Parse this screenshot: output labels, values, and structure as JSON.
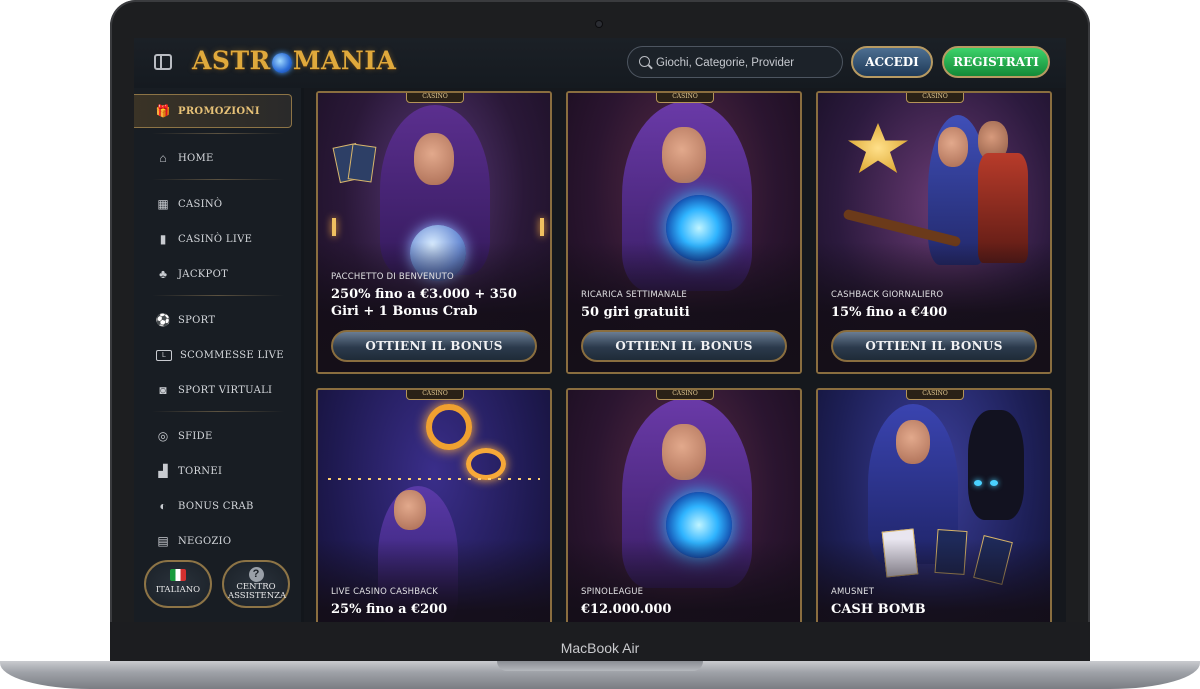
{
  "device": {
    "label": "MacBook Air"
  },
  "header": {
    "logo_text": "ASTROMANIA",
    "search": {
      "placeholder": "Giochi, Categorie, Provider",
      "value": ""
    },
    "login_label": "ACCEDI",
    "register_label": "REGISTRATI"
  },
  "sidebar": {
    "promo": {
      "label": "PROMOZIONI",
      "icon": "gift-icon"
    },
    "items": [
      {
        "label": "HOME",
        "icon": "home-icon"
      },
      {
        "label": "CASINÒ",
        "icon": "slot-machine-icon"
      },
      {
        "label": "CASINÒ LIVE",
        "icon": "playing-card-icon"
      },
      {
        "label": "JACKPOT",
        "icon": "clover-icon"
      },
      {
        "label": "SPORT",
        "icon": "soccer-ball-icon"
      },
      {
        "label": "SCOMMESSE LIVE",
        "icon": "live-icon"
      },
      {
        "label": "SPORT VIRTUALI",
        "icon": "virtual-sport-icon"
      },
      {
        "label": "SFIDE",
        "icon": "target-icon"
      },
      {
        "label": "TORNEI",
        "icon": "podium-icon"
      },
      {
        "label": "BONUS CRAB",
        "icon": "claw-icon"
      },
      {
        "label": "NEGOZIO",
        "icon": "shop-icon"
      }
    ],
    "language_label": "ITALIANO",
    "help_label": "CENTRO ASSISTENZA"
  },
  "promotions": {
    "badge": "CASINO",
    "cards": [
      {
        "subtitle": "PACCHETTO DI BENVENUTO",
        "title": "250% fino a €3.000 + 350 Giri + 1 Bonus Crab",
        "cta": "OTTIENI IL BONUS"
      },
      {
        "subtitle": "RICARICA SETTIMANALE",
        "title": "50 giri gratuiti",
        "cta": "OTTIENI IL BONUS"
      },
      {
        "subtitle": "CASHBACK GIORNALIERO",
        "title": "15% fino a €400",
        "cta": "OTTIENI IL BONUS"
      },
      {
        "subtitle": "LIVE CASINO CASHBACK",
        "title": "25% fino a €200",
        "cta": ""
      },
      {
        "subtitle": "SPINOLEAGUE",
        "title": "€12.000.000",
        "cta": ""
      },
      {
        "subtitle": "AMUSNET",
        "title": "CASH BOMB",
        "cta": ""
      }
    ]
  },
  "colors": {
    "accent_gold": "#8a6e3f",
    "register_green": "#1fa94a",
    "login_blue": "#2d4c6d"
  }
}
